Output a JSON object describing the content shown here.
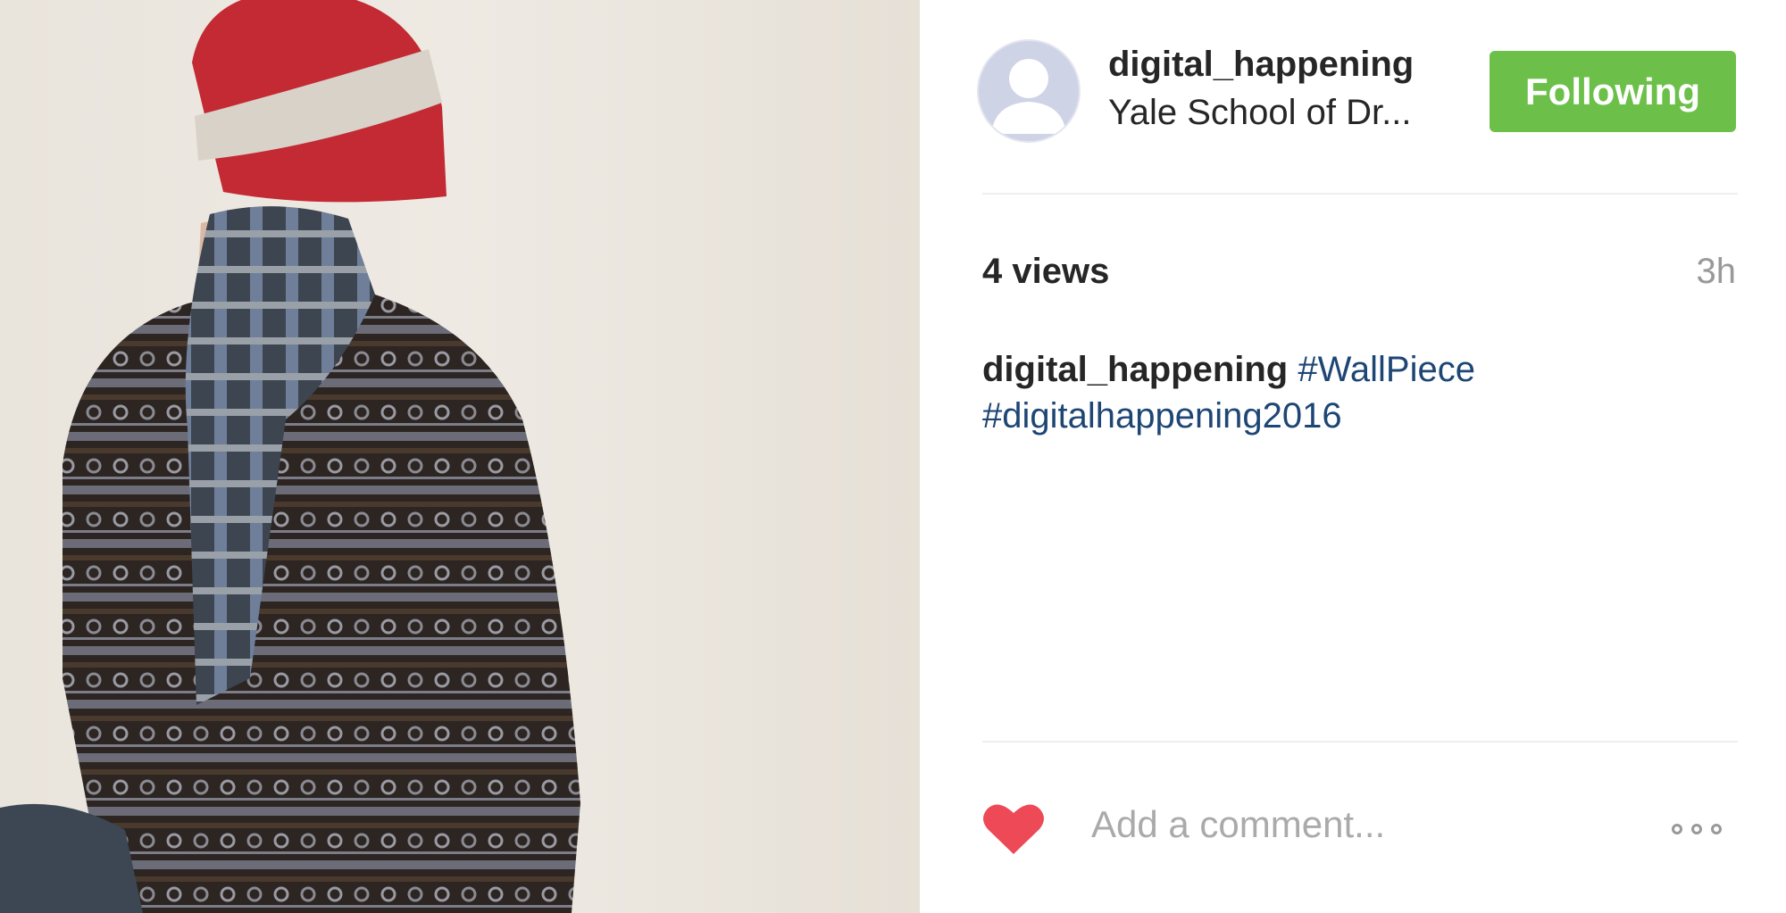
{
  "post": {
    "username": "digital_happening",
    "location": "Yale School of Dr...",
    "follow_label": "Following",
    "views": "4 views",
    "time": "3h",
    "caption_author": "digital_happening",
    "tags": [
      "#WallPiece",
      "#digitalhappening2016"
    ],
    "comment_placeholder": "Add a comment..."
  },
  "colors": {
    "follow_button": "#6cc04a",
    "hashtag": "#1e4675",
    "heart": "#ed4956"
  },
  "icons": {
    "like": "heart-icon",
    "more": "more-options-icon",
    "avatar": "default-avatar-icon"
  }
}
